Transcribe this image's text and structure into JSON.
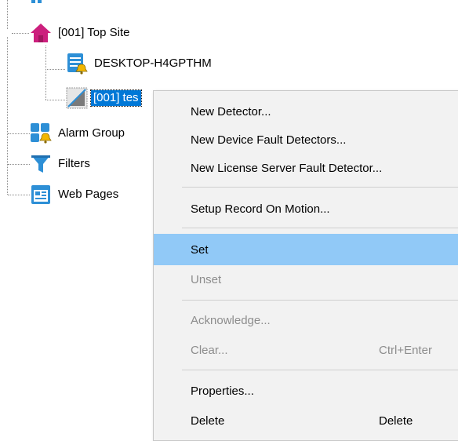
{
  "tree": {
    "nodes": [
      {
        "label": "[001] Top Site",
        "icon": "house-icon"
      },
      {
        "label": "DESKTOP-H4GPTHM",
        "icon": "server-alarm-icon"
      },
      {
        "label": "[001] tes",
        "icon": "camera-detector-icon"
      },
      {
        "label": "Alarm Group",
        "icon": "alarm-group-icon"
      },
      {
        "label": "Filters",
        "icon": "filter-icon"
      },
      {
        "label": "Web Pages",
        "icon": "web-page-icon"
      }
    ]
  },
  "context_menu": {
    "items": [
      {
        "label": "New Detector...",
        "shortcut": ""
      },
      {
        "label": "New Device Fault Detectors...",
        "shortcut": ""
      },
      {
        "label": "New License Server Fault Detector...",
        "shortcut": ""
      },
      {
        "label": "Setup Record On Motion...",
        "shortcut": ""
      },
      {
        "label": "Set",
        "shortcut": ""
      },
      {
        "label": "Unset",
        "shortcut": ""
      },
      {
        "label": "Acknowledge...",
        "shortcut": ""
      },
      {
        "label": "Clear...",
        "shortcut": "Ctrl+Enter"
      },
      {
        "label": "Properties...",
        "shortcut": ""
      },
      {
        "label": "Delete",
        "shortcut": "Delete"
      }
    ]
  },
  "colors": {
    "selection": "#0078d7",
    "menu_hover": "#91c9f7",
    "menu_background": "#f2f2f2",
    "house": "#cc1f7d",
    "icon_blue": "#2d8fd6",
    "bell": "#f2b600"
  }
}
